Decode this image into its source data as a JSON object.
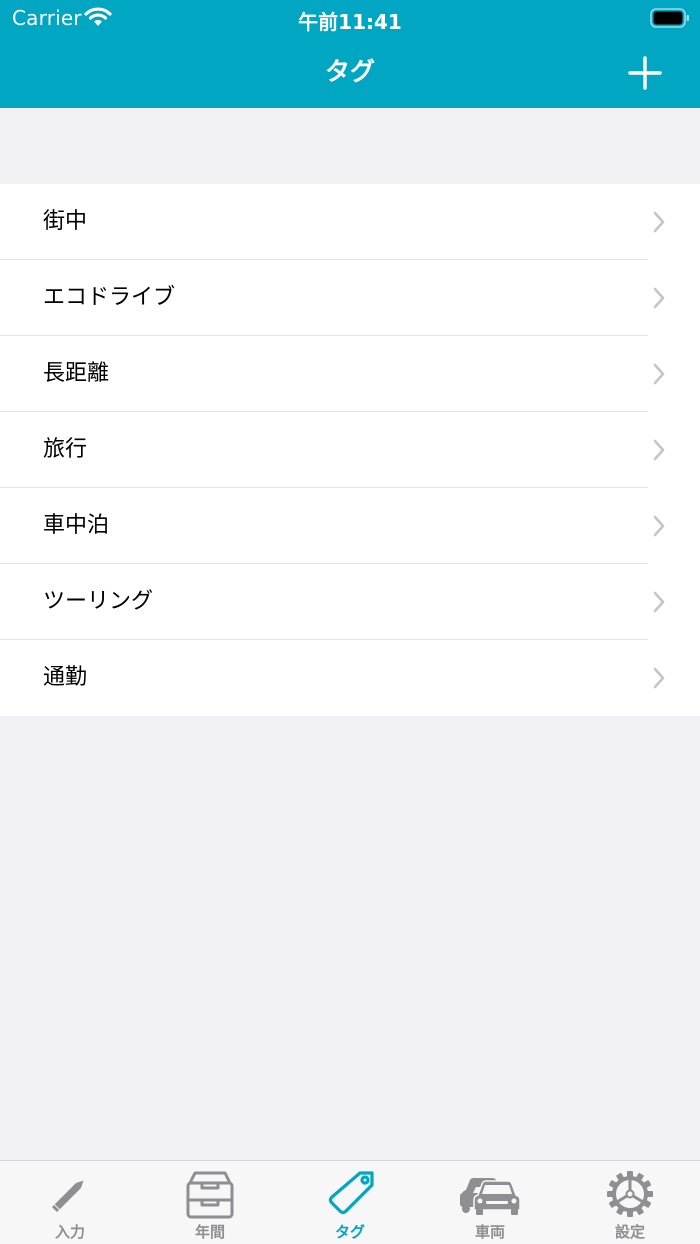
{
  "status_bar": {
    "carrier": "Carrier",
    "time": "午前11:41"
  },
  "navbar": {
    "title": "タグ",
    "add_icon": "plus-icon"
  },
  "tags": [
    {
      "label": "街中"
    },
    {
      "label": "エコドライブ"
    },
    {
      "label": "長距離"
    },
    {
      "label": "旅行"
    },
    {
      "label": "車中泊"
    },
    {
      "label": "ツーリング"
    },
    {
      "label": "通勤"
    }
  ],
  "tabbar": {
    "items": [
      {
        "label": "入力",
        "icon": "pencil-icon"
      },
      {
        "label": "年間",
        "icon": "inbox-tray-icon"
      },
      {
        "label": "タグ",
        "icon": "tag-icon",
        "active": true
      },
      {
        "label": "車両",
        "icon": "cars-icon"
      },
      {
        "label": "設定",
        "icon": "gear-icon"
      }
    ]
  },
  "colors": {
    "accent": "#00a6c2",
    "background": "#f1f1f6",
    "inactive_tab": "#8e8e93",
    "chevron": "#c4c4c9"
  }
}
